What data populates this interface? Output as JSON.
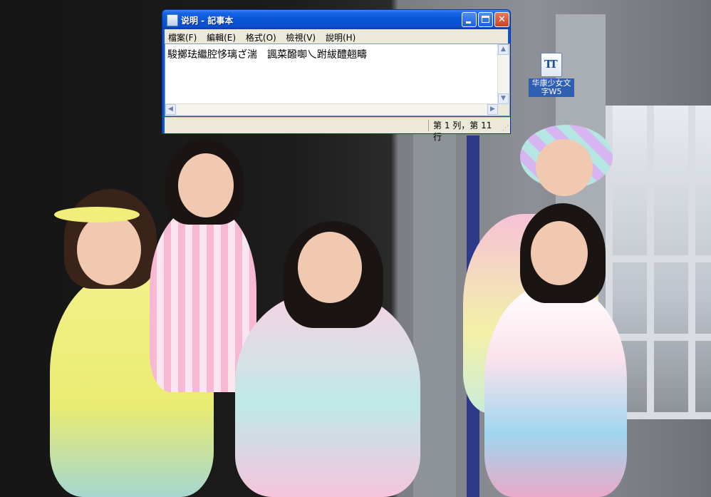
{
  "window": {
    "title": "说明 - 記事本",
    "menus": [
      "檔案(F)",
      "編輯(E)",
      "格式(O)",
      "檢視(V)",
      "說明(H)"
    ],
    "content": "駿擲珐繼腔恀璃ざ湍　諷菜醱啣乀跗紱醴翹疇",
    "status": "第 1 列，第 11 行"
  },
  "desktop_icon": {
    "label": "华康少女文字W5",
    "icon": "truetype-font-icon"
  },
  "colors": {
    "titlebar": "#0a55d8",
    "close_button": "#c94524",
    "menubar": "#ece9d8",
    "icon_label_bg": "#2e5fb3"
  }
}
